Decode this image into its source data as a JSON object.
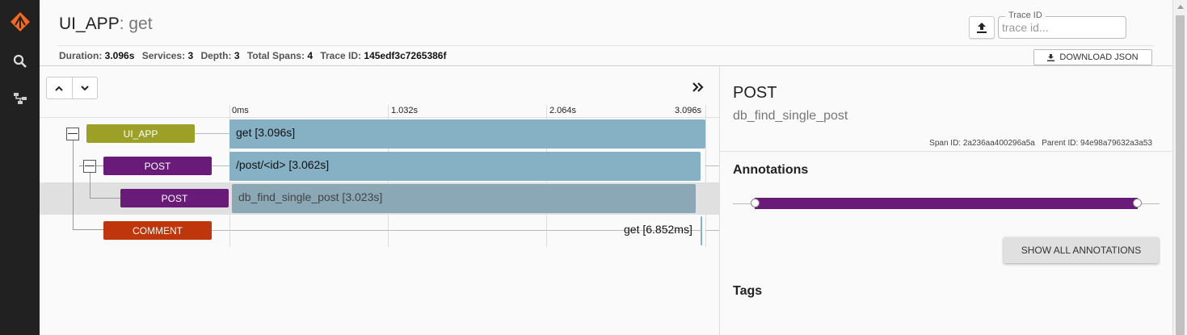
{
  "sidebar": {
    "icons": [
      "logo-icon",
      "search-icon",
      "dependencies-icon"
    ]
  },
  "header": {
    "service_name": "UI_APP",
    "operation_name": ": get",
    "summary": {
      "duration_label": "Duration:",
      "duration_value": "3.096s",
      "services_label": "Services:",
      "services_value": "3",
      "depth_label": "Depth:",
      "depth_value": "3",
      "total_spans_label": "Total Spans:",
      "total_spans_value": "4",
      "trace_id_label": "Trace ID:",
      "trace_id_value": "145edf3c7265386f"
    },
    "trace_input": {
      "legend": "Trace ID",
      "placeholder": "trace id..."
    },
    "download_label": "DOWNLOAD JSON"
  },
  "timeline": {
    "ticks": [
      "0ms",
      "1.032s",
      "2.064s",
      "3.096s"
    ],
    "spans": [
      {
        "service": "UI_APP",
        "color": "#9ca027",
        "label": "get [3.096s]",
        "start_fraction": 0.0,
        "duration_fraction": 1.0
      },
      {
        "service": "POST",
        "color": "#6a1b7a",
        "label": "/post/<id> [3.062s]",
        "start_fraction": 0.0,
        "duration_fraction": 0.989
      },
      {
        "service": "POST",
        "color": "#6a1b7a",
        "label": "db_find_single_post [3.023s]",
        "start_fraction": 0.003,
        "duration_fraction": 0.976,
        "selected": true
      },
      {
        "service": "COMMENT",
        "color": "#bf360c",
        "label": "get [6.852ms]",
        "start_fraction": 0.988,
        "duration_fraction": 0.002
      }
    ],
    "bar_color": "#86b0c4",
    "selected_bar_color": "#8aa8b6"
  },
  "detail": {
    "service": "POST",
    "span_name": "db_find_single_post",
    "span_id_label": "Span ID:",
    "span_id": "2a236aa400296a5a",
    "parent_id_label": "Parent ID:",
    "parent_id": "94e98a79632a3a53",
    "annotations_heading": "Annotations",
    "show_all_label": "SHOW ALL ANNOTATIONS",
    "tags_heading": "Tags"
  }
}
